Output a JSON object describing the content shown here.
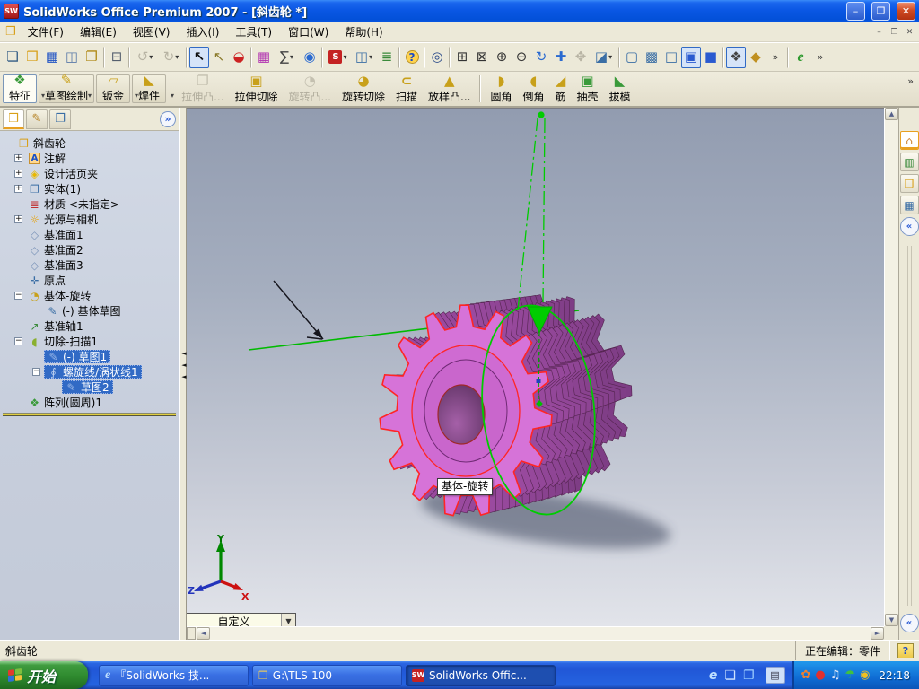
{
  "window": {
    "title": "SolidWorks Office Premium 2007 - [斜齿轮 *]",
    "logo": "SW",
    "controls": {
      "min": "–",
      "restore": "❐",
      "close": "✕"
    }
  },
  "icons": {
    "caret": "▾",
    "overflow": "»",
    "up": "▲",
    "down": "▼",
    "left": "◄",
    "right": "►",
    "chevron": "«",
    "splitter_arrows": "◄ ◄ ◄",
    "menu_toolbox": "❒"
  },
  "menu": {
    "items": [
      {
        "n": "menu-file",
        "label": "文件(F)"
      },
      {
        "n": "menu-edit",
        "label": "编辑(E)"
      },
      {
        "n": "menu-view",
        "label": "视图(V)"
      },
      {
        "n": "menu-insert",
        "label": "插入(I)"
      },
      {
        "n": "menu-tools",
        "label": "工具(T)"
      },
      {
        "n": "menu-window",
        "label": "窗口(W)"
      },
      {
        "n": "menu-help",
        "label": "帮助(H)"
      }
    ]
  },
  "toolbar_main": {
    "icons": [
      {
        "n": "new-document-button",
        "g": "❏",
        "st": "color:#335c85",
        "cls": "",
        "i": "true"
      },
      {
        "n": "open-button",
        "g": "❒",
        "st": "color:#d8a01a",
        "cls": "",
        "i": "true"
      },
      {
        "n": "save-button",
        "g": "▦",
        "st": "color:#2053c4",
        "cls": "",
        "i": "true"
      },
      {
        "n": "make-drawing-button",
        "g": "◫",
        "st": "color:#5a7aa8",
        "cls": "",
        "i": "true"
      },
      {
        "n": "make-assembly-button",
        "g": "❐",
        "st": "color:#b08a18",
        "cls": "",
        "i": "true"
      },
      {
        "n": "toolbar-separator",
        "g": "",
        "st": "",
        "cls": "tsep",
        "i": "false"
      },
      {
        "n": "print-button",
        "g": "⊟",
        "st": "color:#555f6e",
        "cls": "",
        "i": "true"
      },
      {
        "n": "toolbar-separator",
        "g": "",
        "st": "",
        "cls": "tsep",
        "i": "false"
      },
      {
        "n": "undo-button",
        "g": "↺",
        "st": "",
        "cls": "dd disabled",
        "i": "false"
      },
      {
        "n": "redo-button",
        "g": "↻",
        "st": "",
        "cls": "dd disabled",
        "i": "false"
      },
      {
        "n": "toolbar-separator",
        "g": "",
        "st": "",
        "cls": "tsep",
        "i": "false"
      },
      {
        "n": "select-button",
        "g": "↖",
        "st": "color:#111;font-weight:bold",
        "cls": "pressed",
        "i": "true"
      },
      {
        "n": "selection-filter-button",
        "g": "↖",
        "st": "color:#8a7a2a",
        "cls": "",
        "i": "true"
      },
      {
        "n": "traffic-light-button",
        "g": "◒",
        "st": "color:#cc2222",
        "cls": "",
        "i": "true"
      },
      {
        "n": "toolbar-separator",
        "g": "",
        "st": "",
        "cls": "tsep",
        "i": "false"
      },
      {
        "n": "color-palette-button",
        "g": "▦",
        "st": "color:#b030b0",
        "cls": "",
        "i": "true"
      },
      {
        "n": "measure-button",
        "g": "∑",
        "st": "color:#444",
        "cls": "dd",
        "i": "true"
      },
      {
        "n": "search-button",
        "g": "◉",
        "st": "color:#2a6ad0",
        "cls": "",
        "i": "true"
      },
      {
        "n": "toolbar-separator",
        "g": "",
        "st": "",
        "cls": "tsep",
        "i": "false"
      },
      {
        "n": "solidworks-office-button",
        "g": "S",
        "st": "",
        "cls": "swbox dd",
        "i": "true"
      },
      {
        "n": "view-layout-button",
        "g": "◫",
        "st": "color:#3a6ea5",
        "cls": "dd",
        "i": "true"
      },
      {
        "n": "options-list-button",
        "g": "≣",
        "st": "color:#3a8a3a",
        "cls": "",
        "i": "true"
      },
      {
        "n": "toolbar-separator",
        "g": "",
        "st": "",
        "cls": "tsep",
        "i": "false"
      },
      {
        "n": "help-button",
        "g": "?",
        "st": "",
        "cls": "helpdot",
        "i": "true"
      },
      {
        "n": "toolbar-separator",
        "g": "",
        "st": "",
        "cls": "tsep",
        "i": "false"
      },
      {
        "n": "zoom-to-selection-button",
        "g": "◎",
        "st": "color:#2a4a8a",
        "cls": "",
        "i": "true"
      },
      {
        "n": "toolbar-separator",
        "g": "",
        "st": "",
        "cls": "tsep",
        "i": "false"
      },
      {
        "n": "zoom-area-button",
        "g": "⊞",
        "st": "color:#333",
        "cls": "",
        "i": "true"
      },
      {
        "n": "zoom-fit-button",
        "g": "⊠",
        "st": "color:#333",
        "cls": "",
        "i": "true"
      },
      {
        "n": "zoom-in-out-button",
        "g": "⊕",
        "st": "color:#333",
        "cls": "",
        "i": "true"
      },
      {
        "n": "zoom-out-button",
        "g": "⊖",
        "st": "color:#333",
        "cls": "",
        "i": "true"
      },
      {
        "n": "rotate-view-button",
        "g": "↻",
        "st": "color:#2a6ad0",
        "cls": "",
        "i": "true"
      },
      {
        "n": "pan-button",
        "g": "✚",
        "st": "color:#2a6ad0",
        "cls": "",
        "i": "true"
      },
      {
        "n": "rotate-3d-button",
        "g": "✥",
        "st": "",
        "cls": "disabled",
        "i": "false"
      },
      {
        "n": "section-view-button",
        "g": "◪",
        "st": "color:#3a6ea5",
        "cls": "dd",
        "i": "true"
      },
      {
        "n": "toolbar-separator",
        "g": "",
        "st": "",
        "cls": "tsep",
        "i": "false"
      },
      {
        "n": "wireframe-button",
        "g": "▢",
        "st": "color:#3a6ea5",
        "cls": "",
        "i": "true"
      },
      {
        "n": "hidden-lines-visible-button",
        "g": "▩",
        "st": "color:#3a6ea5",
        "cls": "",
        "i": "true"
      },
      {
        "n": "hidden-lines-removed-button",
        "g": "□",
        "st": "color:#3a6ea5",
        "cls": "",
        "i": "true"
      },
      {
        "n": "shaded-with-edges-button",
        "g": "▣",
        "st": "color:#2a5ad0",
        "cls": "pressed",
        "i": "true"
      },
      {
        "n": "shaded-button",
        "g": "■",
        "st": "color:#2a5ad0",
        "cls": "",
        "i": "true"
      },
      {
        "n": "toolbar-separator",
        "g": "",
        "st": "",
        "cls": "tsep",
        "i": "false"
      },
      {
        "n": "shadows-button",
        "g": "❖",
        "st": "color:#444",
        "cls": "pressed",
        "i": "true"
      },
      {
        "n": "realview-button",
        "g": "◆",
        "st": "color:#c09020",
        "cls": "",
        "i": "true"
      },
      {
        "n": "toolbar-overflow-button",
        "g": "»",
        "st": "color:#333",
        "cls": "ovfl",
        "i": "true"
      },
      {
        "n": "toolbar-separator",
        "g": "",
        "st": "",
        "cls": "tsep",
        "i": "false"
      },
      {
        "n": "edrawings-button",
        "g": "e",
        "st": "",
        "cls": "egreen",
        "i": "true"
      },
      {
        "n": "toolbar-overflow-button",
        "g": "»",
        "st": "color:#333",
        "cls": "ovfl",
        "i": "true"
      }
    ]
  },
  "command_manager": {
    "tabs": [
      {
        "n": "tab-features",
        "label": "特征",
        "g": "❖",
        "gst": "color:#3a9a3a",
        "cls": "active",
        "i": "true"
      },
      {
        "n": "tab-sketch",
        "label": "草图绘制",
        "g": "✎",
        "gst": "color:#c8a01a",
        "cls": "",
        "i": "true"
      },
      {
        "n": "tab-sheet-metal",
        "label": "钣金",
        "g": "▱",
        "gst": "color:#c8a01a",
        "cls": "",
        "i": "true"
      },
      {
        "n": "tab-weldments",
        "label": "焊件",
        "g": "◣",
        "gst": "color:#c8a01a",
        "cls": "",
        "i": "true"
      }
    ],
    "buttons": [
      {
        "n": "extruded-boss-button",
        "label": "拉伸凸...",
        "g": "❐",
        "gst": "",
        "cls": "disabled",
        "i": "false"
      },
      {
        "n": "extruded-cut-button",
        "label": "拉伸切除",
        "g": "▣",
        "gst": "color:#c8a01a",
        "cls": "",
        "i": "true"
      },
      {
        "n": "revolved-boss-button",
        "label": "旋转凸...",
        "g": "◔",
        "gst": "",
        "cls": "disabled",
        "i": "false"
      },
      {
        "n": "revolved-cut-button",
        "label": "旋转切除",
        "g": "◕",
        "gst": "color:#c8a01a",
        "cls": "",
        "i": "true"
      },
      {
        "n": "sweep-button",
        "label": "扫描",
        "g": "⊂",
        "gst": "color:#c8a01a;font-weight:bold",
        "cls": "",
        "i": "true"
      },
      {
        "n": "lofted-boss-button",
        "label": "放样凸...",
        "g": "▲",
        "gst": "color:#c8a01a",
        "cls": "",
        "i": "true"
      },
      {
        "n": "cm-separator",
        "label": "",
        "g": "",
        "gst": "",
        "cls": "csep",
        "i": "false"
      },
      {
        "n": "fillet-button",
        "label": "圆角",
        "g": "◗",
        "gst": "color:#c8a01a",
        "cls": "",
        "i": "true"
      },
      {
        "n": "chamfer-button",
        "label": "倒角",
        "g": "◖",
        "gst": "color:#c8a01a",
        "cls": "",
        "i": "true"
      },
      {
        "n": "rib-button",
        "label": "筋",
        "g": "◢",
        "gst": "color:#c8a01a",
        "cls": "",
        "i": "true"
      },
      {
        "n": "shell-button",
        "label": "抽壳",
        "g": "▣",
        "gst": "color:#3a9a3a",
        "cls": "",
        "i": "true"
      },
      {
        "n": "draft-button",
        "label": "拔模",
        "g": "◣",
        "gst": "color:#3a9a3a",
        "cls": "",
        "i": "true"
      }
    ]
  },
  "feature_tree": {
    "items": [
      {
        "n": "tree-item-part-root",
        "lbl": "斜齿轮",
        "g": "❒",
        "gst": "color:#d8a01a",
        "ist": "padding-left:4px",
        "exp": "",
        "ecls": "noexp",
        "cls": ""
      },
      {
        "n": "tree-item-annotations",
        "lbl": "注解",
        "g": "A",
        "gst": "color:#1a50c8;background:#ffd890;border:1px solid #c89030;font-size:10px;font-weight:bold;width:13px;height:13px;line-height:11px",
        "ist": "padding-left:16px",
        "exp": "+",
        "ecls": "",
        "cls": ""
      },
      {
        "n": "tree-item-design-binder",
        "lbl": "设计活页夹",
        "g": "◈",
        "gst": "color:#e8b800",
        "ist": "padding-left:16px",
        "exp": "+",
        "ecls": "",
        "cls": ""
      },
      {
        "n": "tree-item-solid-bodies",
        "lbl": "实体(1)",
        "g": "❐",
        "gst": "color:#3a6ea5",
        "ist": "padding-left:16px",
        "exp": "+",
        "ecls": "",
        "cls": ""
      },
      {
        "n": "tree-item-material",
        "lbl": "材质 <未指定>",
        "g": "≣",
        "gst": "color:#c03030",
        "ist": "padding-left:16px",
        "exp": "",
        "ecls": "noexp",
        "cls": ""
      },
      {
        "n": "tree-item-lights-cameras",
        "lbl": "光源与相机",
        "g": "☼",
        "gst": "color:#e8a000",
        "ist": "padding-left:16px",
        "exp": "+",
        "ecls": "",
        "cls": ""
      },
      {
        "n": "tree-item-plane1",
        "lbl": "基准面1",
        "g": "◇",
        "gst": "color:#7a93b8",
        "ist": "padding-left:16px",
        "exp": "",
        "ecls": "noexp",
        "cls": ""
      },
      {
        "n": "tree-item-plane2",
        "lbl": "基准面2",
        "g": "◇",
        "gst": "color:#7a93b8",
        "ist": "padding-left:16px",
        "exp": "",
        "ecls": "noexp",
        "cls": ""
      },
      {
        "n": "tree-item-plane3",
        "lbl": "基准面3",
        "g": "◇",
        "gst": "color:#7a93b8",
        "ist": "padding-left:16px",
        "exp": "",
        "ecls": "noexp",
        "cls": ""
      },
      {
        "n": "tree-item-origin",
        "lbl": "原点",
        "g": "✛",
        "gst": "color:#3a6ea5",
        "ist": "padding-left:16px",
        "exp": "",
        "ecls": "noexp",
        "cls": ""
      },
      {
        "n": "tree-item-base-revolve",
        "lbl": "基体-旋转",
        "g": "◔",
        "gst": "color:#c8a01a",
        "ist": "padding-left:16px",
        "exp": "−",
        "ecls": "",
        "cls": ""
      },
      {
        "n": "tree-item-base-sketch",
        "lbl": "(-) 基体草图",
        "g": "✎",
        "gst": "color:#3a6ea5",
        "ist": "padding-left:36px",
        "exp": "",
        "ecls": "noexp",
        "cls": ""
      },
      {
        "n": "tree-item-axis1",
        "lbl": "基准轴1",
        "g": "↗",
        "gst": "color:#3a8a3a",
        "ist": "padding-left:16px",
        "exp": "",
        "ecls": "noexp",
        "cls": ""
      },
      {
        "n": "tree-item-cut-sweep1",
        "lbl": "切除-扫描1",
        "g": "◖",
        "gst": "color:#8ab030",
        "ist": "padding-left:16px",
        "exp": "−",
        "ecls": "",
        "cls": ""
      },
      {
        "n": "tree-item-sketch1",
        "lbl": "(-) 草图1",
        "g": "✎",
        "gst": "color:#9ab8e8",
        "ist": "padding-left:36px",
        "exp": "",
        "ecls": "noexp",
        "cls": "sel"
      },
      {
        "n": "tree-item-helix1",
        "lbl": "螺旋线/涡状线1",
        "g": "∮",
        "gst": "color:#bcd0f0",
        "ist": "padding-left:36px",
        "exp": "−",
        "ecls": "",
        "cls": "sel"
      },
      {
        "n": "tree-item-sketch2",
        "lbl": "草图2",
        "g": "✎",
        "gst": "color:#9ab8e8",
        "ist": "padding-left:56px",
        "exp": "",
        "ecls": "noexp",
        "cls": "sel"
      },
      {
        "n": "tree-item-pattern-circular",
        "lbl": "阵列(圆周)1",
        "g": "❖",
        "gst": "color:#3a9a3a",
        "ist": "padding-left:16px",
        "exp": "",
        "ecls": "noexp",
        "cls": ""
      },
      {
        "n": "rollback-bar",
        "lbl": "",
        "g": "",
        "gst": "",
        "ist": "",
        "exp": "",
        "ecls": "noexp",
        "cls": "rollback"
      }
    ]
  },
  "fm_header": {
    "tabs": [
      {
        "n": "featuremanager-tree-tab",
        "g": "❒",
        "gst": "color:#d8a01a",
        "cls": "active",
        "i": "true"
      },
      {
        "n": "propertymanager-tab",
        "g": "✎",
        "gst": "color:#b8862a",
        "cls": "",
        "i": "true"
      },
      {
        "n": "configurationmanager-tab",
        "g": "❐",
        "gst": "color:#3a6ea5",
        "cls": "",
        "i": "true"
      }
    ]
  },
  "task_pane": {
    "tabs": [
      {
        "n": "solidworks-resources-tab",
        "g": "⌂",
        "gst": "color:#c87820",
        "cls": "active",
        "i": "true"
      },
      {
        "n": "design-library-tab",
        "g": "▥",
        "gst": "color:#3a8a3a",
        "cls": "",
        "i": "true"
      },
      {
        "n": "file-explorer-tab",
        "g": "❒",
        "gst": "color:#d8a01a",
        "cls": "",
        "i": "true"
      },
      {
        "n": "drag-drop-palette-tab",
        "g": "▦",
        "gst": "color:#3a6ea5",
        "cls": "",
        "i": "true"
      },
      {
        "n": "collapse-taskpane-button",
        "g": "«",
        "gst": "",
        "cls": "chev",
        "i": "true"
      }
    ]
  },
  "viewport": {
    "tooltip": "基体-旋转",
    "view_combo": "自定义",
    "triad": {
      "x": "X",
      "y": "Y",
      "z": "Z"
    }
  },
  "status_bar": {
    "left": "斜齿轮",
    "editing": "正在编辑：零件",
    "help": "?"
  },
  "taskbar": {
    "start_label": "开始",
    "tasks": [
      {
        "n": "taskbar-task-browser",
        "label": "『SolidWorks 技...",
        "g": "e",
        "gcls": "ie",
        "cls": "",
        "i": "true"
      },
      {
        "n": "taskbar-task-folder",
        "label": "G:\\TLS-100",
        "g": "❒",
        "gcls": "folder",
        "cls": "",
        "i": "true"
      },
      {
        "n": "taskbar-task-solidworks",
        "label": "SolidWorks Offic...",
        "g": "SW",
        "gcls": "sw",
        "cls": "pressed",
        "i": "true"
      }
    ],
    "quick_launch": [
      {
        "n": "quick-launch-ie-icon",
        "g": "e",
        "st": "color:#bfe0ff;font-weight:bold;font-style:italic"
      },
      {
        "n": "quick-launch-desktop-icon",
        "g": "❏",
        "st": "color:#cfe4ff"
      },
      {
        "n": "quick-launch-app-icon",
        "g": "❐",
        "st": "color:#9fd0ff"
      }
    ],
    "language_indicator": "▤",
    "tray": [
      {
        "n": "tray-antivirus-icon",
        "g": "✿",
        "st": "color:#f08030"
      },
      {
        "n": "tray-security-icon",
        "g": "●",
        "st": "color:#e03030"
      },
      {
        "n": "tray-volume-icon",
        "g": "♫",
        "st": "color:#d8e4f8"
      },
      {
        "n": "tray-umbrella-icon",
        "g": "☂",
        "st": "color:#40c040"
      },
      {
        "n": "tray-network-icon",
        "g": "◉",
        "st": "color:#f0c020"
      }
    ],
    "clock": "22:18"
  }
}
